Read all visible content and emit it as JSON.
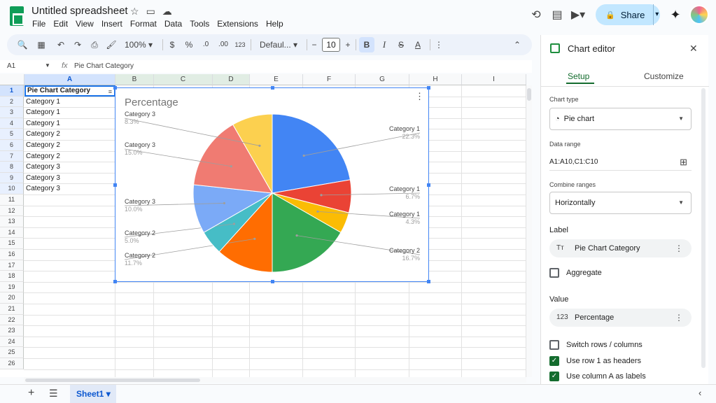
{
  "app": {
    "doc_title": "Untitled spreadsheet",
    "menu": [
      "File",
      "Edit",
      "View",
      "Insert",
      "Format",
      "Data",
      "Tools",
      "Extensions",
      "Help"
    ],
    "share_label": "Share"
  },
  "toolbar": {
    "zoom": "100%",
    "currency": "$",
    "percent": "%",
    "dec_minus": ".0",
    "dec_plus": ".00",
    "number_format": "123",
    "font": "Defaul...",
    "font_size": "10",
    "bold": "B",
    "italic": "I"
  },
  "formula_bar": {
    "name_box": "A1",
    "fx": "fx",
    "value": "Pie Chart Category"
  },
  "grid": {
    "columns": [
      "A",
      "B",
      "C",
      "D",
      "E",
      "F",
      "G",
      "H",
      "I"
    ],
    "rows": [
      "1",
      "2",
      "3",
      "4",
      "5",
      "6",
      "7",
      "8",
      "9",
      "10",
      "11",
      "12",
      "13",
      "14",
      "15",
      "16",
      "17",
      "18",
      "19",
      "20",
      "21",
      "22",
      "23",
      "24",
      "25",
      "26"
    ],
    "col_a": [
      "Pie Chart Category",
      "Category 1",
      "Category 1",
      "Category 1",
      "Category 2",
      "Category 2",
      "Category 2",
      "Category 3",
      "Category 3",
      "Category 3"
    ]
  },
  "sheet_tab": "Sheet1",
  "chart_data": {
    "type": "pie",
    "title": "Percentage",
    "slices": [
      {
        "label": "Category 1",
        "value": 22.3,
        "display": "22.3%",
        "color": "#4285f4"
      },
      {
        "label": "Category 1",
        "value": 6.7,
        "display": "6.7%",
        "color": "#ea4335"
      },
      {
        "label": "Category 1",
        "value": 4.3,
        "display": "4.3%",
        "color": "#fbbc04"
      },
      {
        "label": "Category 2",
        "value": 16.7,
        "display": "16.7%",
        "color": "#34a853"
      },
      {
        "label": "Category 2",
        "value": 11.7,
        "display": "11.7%",
        "color": "#ff6d01"
      },
      {
        "label": "Category 2",
        "value": 5.0,
        "display": "5.0%",
        "color": "#46bdc6"
      },
      {
        "label": "Category 3",
        "value": 10.0,
        "display": "10.0%",
        "color": "#7baaf7"
      },
      {
        "label": "Category 3",
        "value": 15.0,
        "display": "15.0%",
        "color": "#f07b72"
      },
      {
        "label": "Category 3",
        "value": 8.3,
        "display": "8.3%",
        "color": "#fcd04f"
      }
    ]
  },
  "chart_editor": {
    "title": "Chart editor",
    "tabs": [
      "Setup",
      "Customize"
    ],
    "chart_type_label": "Chart type",
    "chart_type_value": "Pie chart",
    "data_range_label": "Data range",
    "data_range_value": "A1:A10,C1:C10",
    "combine_label": "Combine ranges",
    "combine_value": "Horizontally",
    "label_heading": "Label",
    "label_chip": "Pie Chart Category",
    "aggregate": "Aggregate",
    "value_heading": "Value",
    "value_chip": "Percentage",
    "value_chip_icon": "123",
    "label_chip_icon": "Tт",
    "switch_rows": "Switch rows / columns",
    "use_row1": "Use row 1 as headers",
    "use_colA": "Use column A as labels"
  }
}
